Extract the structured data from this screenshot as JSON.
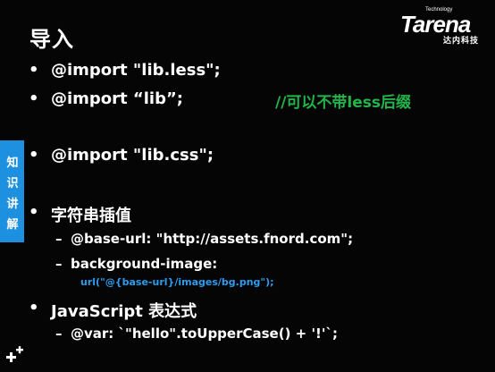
{
  "slide": {
    "title": "导入",
    "logo": {
      "tagline": "Technology",
      "brand": "Tarena",
      "subtitle": "达内科技"
    },
    "bullets": [
      {
        "text": "@import \"lib.less\";"
      },
      {
        "text": "@import “lib”;"
      },
      {
        "text": "@import \"lib.css\";"
      },
      {
        "text": "字符串插值"
      },
      {
        "text": "JavaScript 表达式"
      }
    ],
    "comment": "//可以不带less后缀",
    "sub_items": [
      "@base-url: \"http://assets.fnord.com\";",
      "background-image:",
      "@var: `\"hello\".toUpperCase()  + '!'`;"
    ],
    "code_line": "url(\"@{base-url}/images/bg.png\");",
    "side_tab": [
      "知",
      "识",
      "讲",
      "解"
    ],
    "bullet_symbol": "•",
    "dash_symbol": "–",
    "icons": {
      "corner": "plus-cluster-icon"
    },
    "colors": {
      "comment": "#22b54a",
      "code": "#2a9df0",
      "tab": "#1e90e0"
    }
  }
}
